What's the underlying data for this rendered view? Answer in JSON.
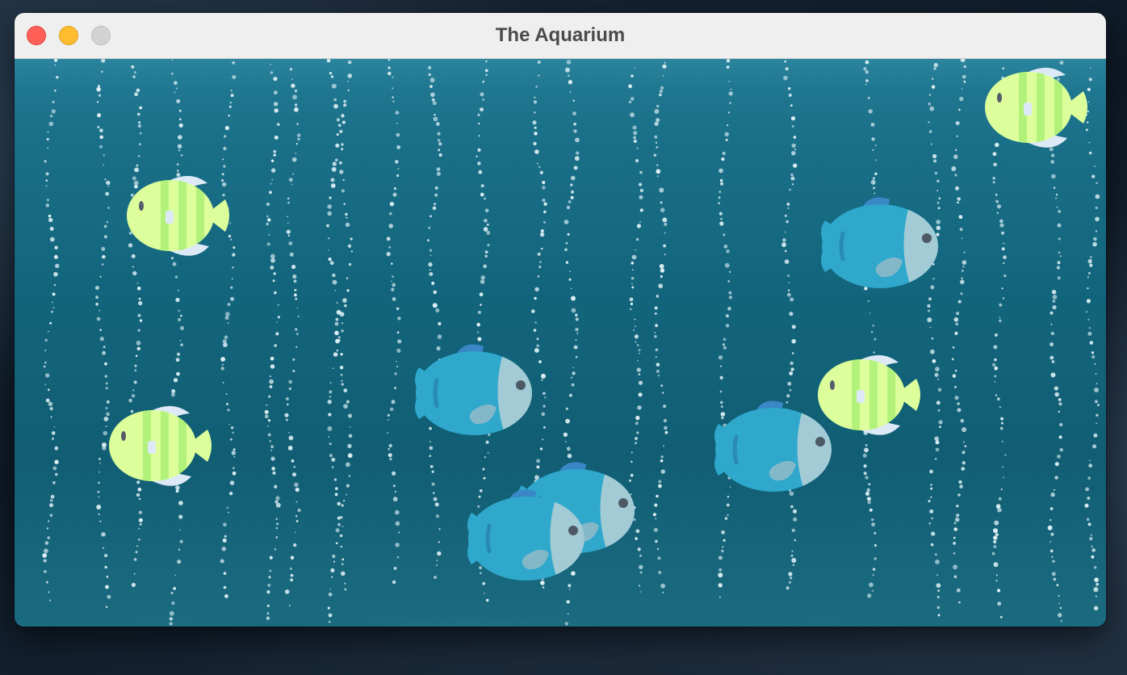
{
  "window": {
    "title": "The Aquarium"
  },
  "scene": {
    "name": "aquarium",
    "fish": [
      {
        "kind": "striped-green",
        "facing": "left"
      },
      {
        "kind": "striped-green",
        "facing": "left"
      },
      {
        "kind": "striped-green",
        "facing": "left"
      },
      {
        "kind": "striped-green",
        "facing": "left"
      },
      {
        "kind": "blue",
        "facing": "right"
      },
      {
        "kind": "blue",
        "facing": "right"
      },
      {
        "kind": "blue",
        "facing": "right"
      },
      {
        "kind": "blue",
        "facing": "right"
      },
      {
        "kind": "blue",
        "facing": "right"
      }
    ]
  },
  "colors": {
    "water": "#12657c",
    "blue_fish_body": "#2fa8cc",
    "blue_fish_head": "#a2cbd6",
    "green_fish_body": "#dcff9c",
    "green_fish_stripe": "#b3f27a",
    "fin": "#dde9f7"
  }
}
